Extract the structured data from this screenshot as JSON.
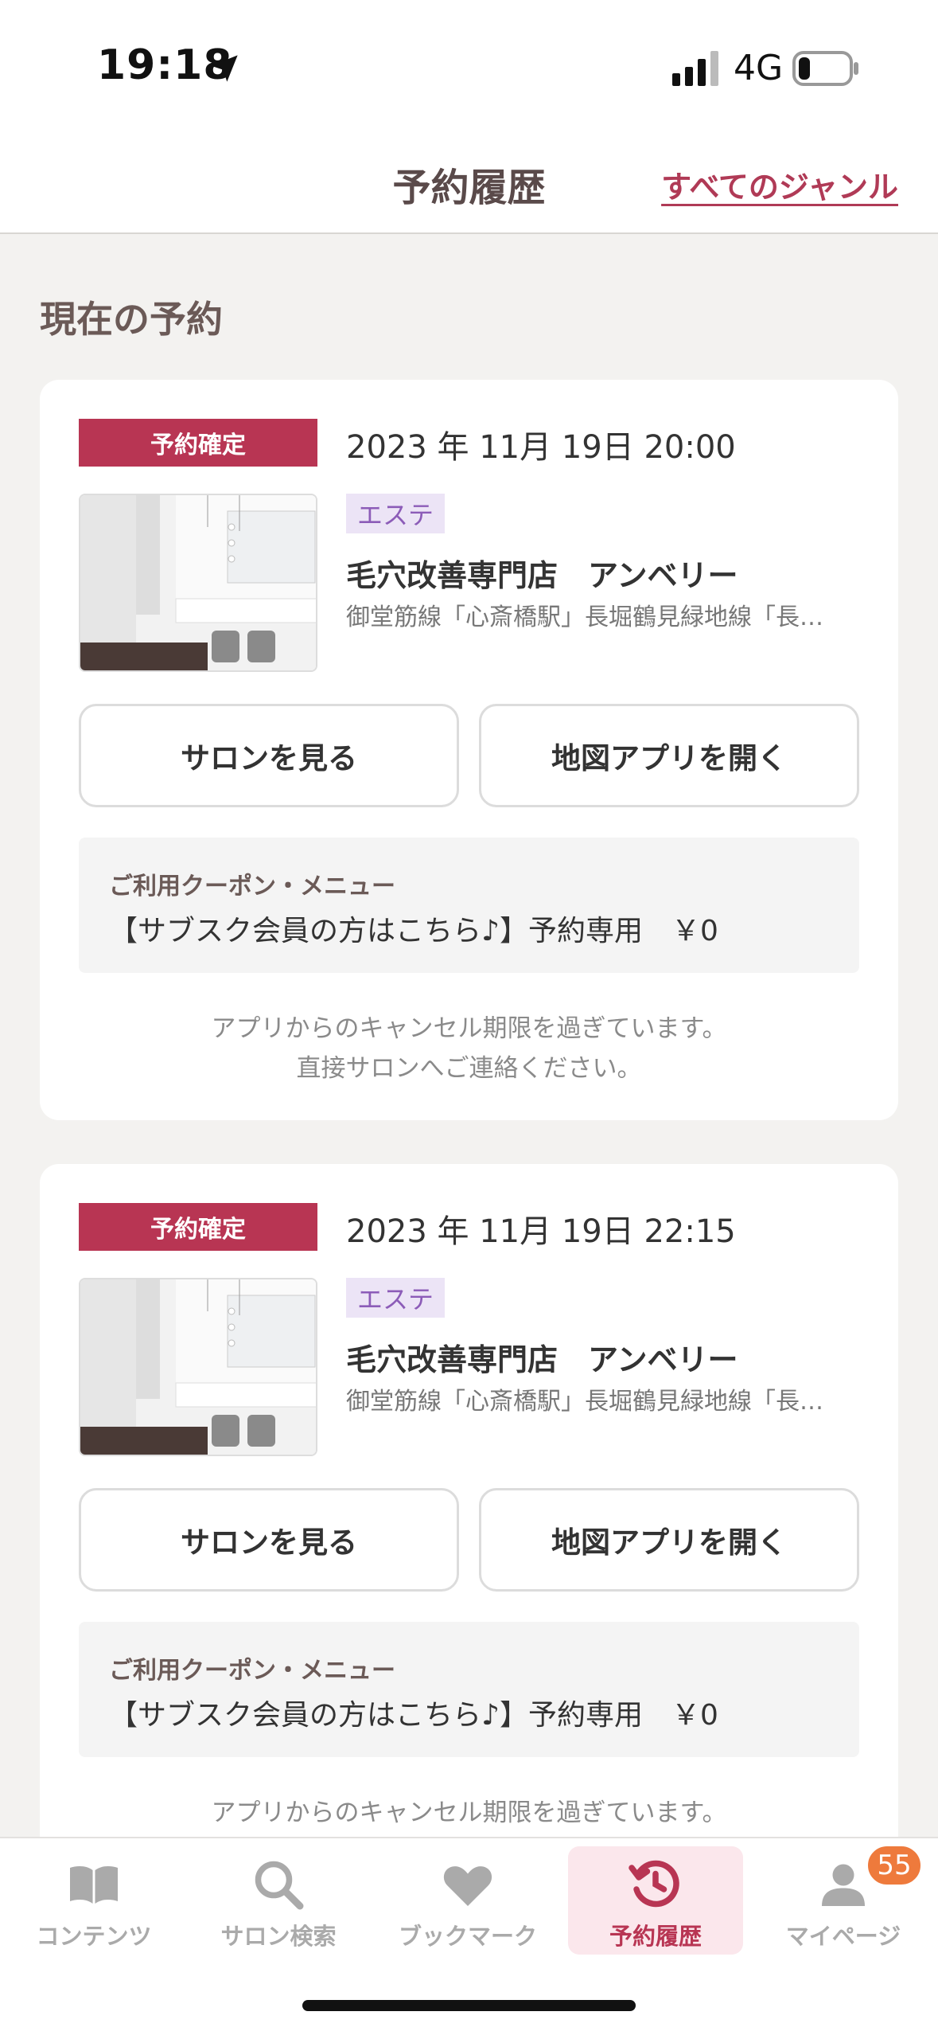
{
  "status_bar": {
    "time": "19:18",
    "network": "4G"
  },
  "header": {
    "title": "予約履歴",
    "genre_link": "すべてのジャンル"
  },
  "section": {
    "title": "現在の予約"
  },
  "reservations": [
    {
      "status": "予約確定",
      "datetime": "2023 年 11月 19日  20:00",
      "genre": "エステ",
      "salon_name": "毛穴改善専門店　アンベリー",
      "access": "御堂筋線「心斎橋駅」長堀鶴見緑地線「長…",
      "view_salon_label": "サロンを見る",
      "open_map_label": "地図アプリを開く",
      "coupon_label": "ご利用クーポン・メニュー",
      "coupon_menu": "【サブスク会員の方はこちら♪】予約専用　￥0",
      "cancel_note_1": "アプリからのキャンセル期限を過ぎています。",
      "cancel_note_2": "直接サロンへご連絡ください。"
    },
    {
      "status": "予約確定",
      "datetime": "2023 年 11月 19日  22:15",
      "genre": "エステ",
      "salon_name": "毛穴改善専門店　アンベリー",
      "access": "御堂筋線「心斎橋駅」長堀鶴見緑地線「長…",
      "view_salon_label": "サロンを見る",
      "open_map_label": "地図アプリを開く",
      "coupon_label": "ご利用クーポン・メニュー",
      "coupon_menu": "【サブスク会員の方はこちら♪】予約専用　￥0",
      "cancel_note_1": "アプリからのキャンセル期限を過ぎています。"
    }
  ],
  "tabbar": {
    "tabs": [
      {
        "label": "コンテンツ",
        "icon": "book-icon"
      },
      {
        "label": "サロン検索",
        "icon": "search-icon"
      },
      {
        "label": "ブックマーク",
        "icon": "heart-icon"
      },
      {
        "label": "予約履歴",
        "icon": "history-clock-icon",
        "active": true
      },
      {
        "label": "マイページ",
        "icon": "person-icon"
      }
    ],
    "mypage_badge": "55"
  },
  "colors": {
    "accent": "#b83553",
    "badge_orange": "#ee7a3c",
    "genre_bg": "#ece4f6",
    "genre_text": "#8c5cb8"
  }
}
